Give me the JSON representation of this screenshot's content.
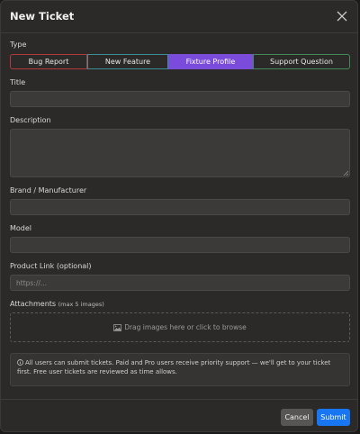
{
  "dialog": {
    "title": "New Ticket",
    "close_icon": "close-icon"
  },
  "type": {
    "label": "Type",
    "options": [
      "Bug Report",
      "New Feature",
      "Fixture Profile",
      "Support Question"
    ],
    "selected": "Fixture Profile",
    "colors": {
      "bug": "#b23a3a",
      "feature": "#3a8f96",
      "fixture": "#7b4bdc",
      "support": "#3f8a55"
    }
  },
  "fields": {
    "title_label": "Title",
    "title_value": "",
    "description_label": "Description",
    "description_value": "",
    "brand_label": "Brand / Manufacturer",
    "brand_value": "",
    "model_label": "Model",
    "model_value": "",
    "link_label": "Product Link (optional)",
    "link_placeholder": "https://..."
  },
  "attachments": {
    "label": "Attachments",
    "hint": "(max 5 images)",
    "dropzone_text": "Drag images here or click to browse",
    "icon": "image-icon"
  },
  "info": {
    "icon": "info-icon",
    "text": "All users can submit tickets. Paid and Pro users receive priority support — we'll get to your ticket first. Free user tickets are reviewed as time allows."
  },
  "footer": {
    "cancel_label": "Cancel",
    "submit_label": "Submit",
    "submit_color": "#1976f2"
  }
}
